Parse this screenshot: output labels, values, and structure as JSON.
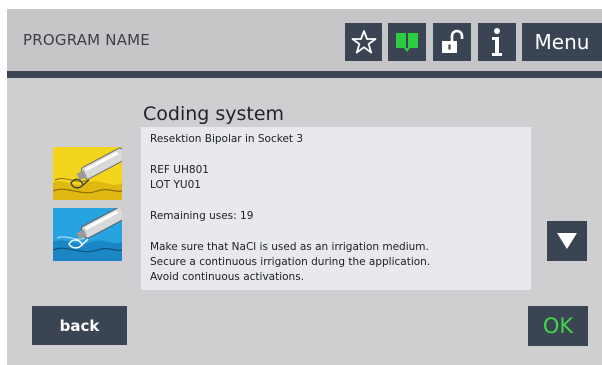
{
  "header": {
    "program_name": "PROGRAM NAME",
    "menu_label": "Menu",
    "icons": [
      "star-outline-icon",
      "book-icon",
      "unlock-icon",
      "info-icon"
    ],
    "book_icon_color": "#2ecc40"
  },
  "main": {
    "title": "Coding system",
    "lines": [
      "Resektion Bipolar in Socket  3",
      "REF UH801",
      "LOT YU01",
      "Remaining uses: 19",
      "Make sure that NaCl is used as an irrigation medium.",
      "Secure a continuous irrigation during the application.",
      "Avoid continuous activations."
    ]
  },
  "images": [
    "resectoscope-yellow-tissue-image",
    "resectoscope-blue-irrigation-image"
  ],
  "controls": {
    "scroll_down_icon": "triangle-down-icon",
    "back_label": "back",
    "ok_label": "OK",
    "ok_color": "#44d64a"
  },
  "colors": {
    "background": "#cfcfd1",
    "button": "#3a4453",
    "text_panel": "#e7e9ed"
  }
}
